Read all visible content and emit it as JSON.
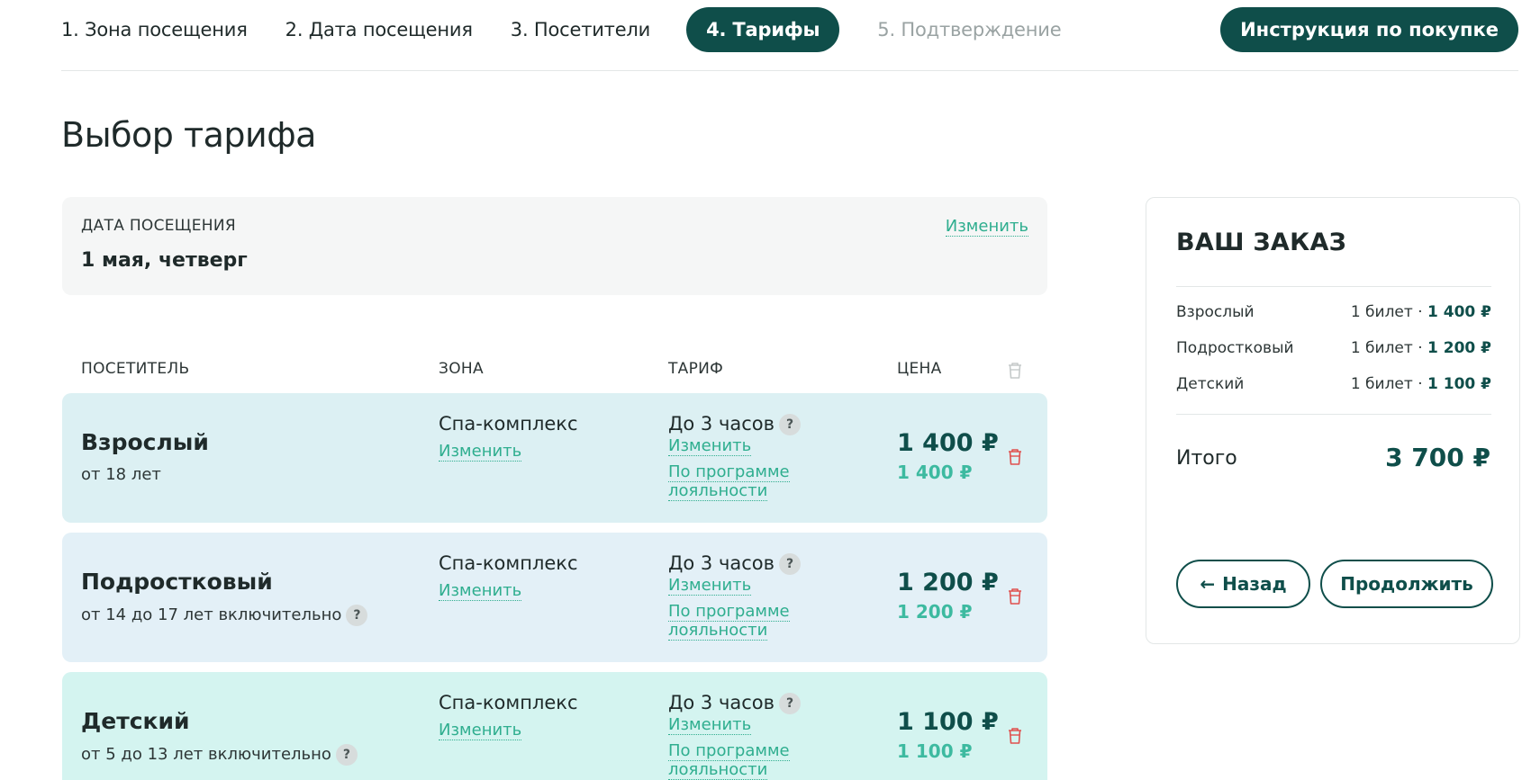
{
  "steps": [
    {
      "label": "1. Зона посещения"
    },
    {
      "label": "2. Дата посещения"
    },
    {
      "label": "3. Посетители"
    },
    {
      "label": "4. Тарифы"
    },
    {
      "label": "5. Подтверждение"
    }
  ],
  "instruction_button": "Инструкция по покупке",
  "page_title": "Выбор тарифа",
  "visit_date": {
    "label": "ДАТА ПОСЕЩЕНИЯ",
    "value": "1 мая, четверг",
    "change": "Изменить"
  },
  "table": {
    "headers": {
      "visitor": "ПОСЕТИТЕЛЬ",
      "zone": "ЗОНА",
      "tariff": "ТАРИФ",
      "price": "ЦЕНА"
    },
    "rows": [
      {
        "name": "Взрослый",
        "age": "от 18 лет",
        "zone": "Спа-комплекс",
        "zone_change": "Изменить",
        "tariff": "До 3 часов",
        "tariff_change": "Изменить",
        "loyalty": "По программе лояльности",
        "price": "1 400 ₽",
        "loyalty_price": "1 400 ₽"
      },
      {
        "name": "Подростковый",
        "age": "от 14 до 17 лет включительно",
        "zone": "Спа-комплекс",
        "zone_change": "Изменить",
        "tariff": "До 3 часов",
        "tariff_change": "Изменить",
        "loyalty": "По программе лояльности",
        "price": "1 200 ₽",
        "loyalty_price": "1 200 ₽"
      },
      {
        "name": "Детский",
        "age": "от 5 до 13 лет включительно",
        "zone": "Спа-комплекс",
        "zone_change": "Изменить",
        "tariff": "До 3 часов",
        "tariff_change": "Изменить",
        "loyalty": "По программе лояльности",
        "price": "1 100 ₽",
        "loyalty_price": "1 100 ₽"
      }
    ]
  },
  "order": {
    "title": "ВАШ ЗАКАЗ",
    "items": [
      {
        "name": "Взрослый",
        "qty": "1 билет",
        "price": "1 400 ₽"
      },
      {
        "name": "Подростковый",
        "qty": "1 билет",
        "price": "1 200 ₽"
      },
      {
        "name": "Детский",
        "qty": "1 билет",
        "price": "1 100 ₽"
      }
    ],
    "total_label": "Итого",
    "total_value": "3 700 ₽",
    "back": "Назад",
    "continue": "Продолжить"
  },
  "question_mark": "?",
  "dot_separator": " · ",
  "colors": {
    "primary": "#0f4e4a",
    "accent": "#2fae8f",
    "danger": "#e0504e",
    "row_adult": "#dcf0f3",
    "row_teen": "#e3f0f7",
    "row_child": "#d4f4f0"
  }
}
